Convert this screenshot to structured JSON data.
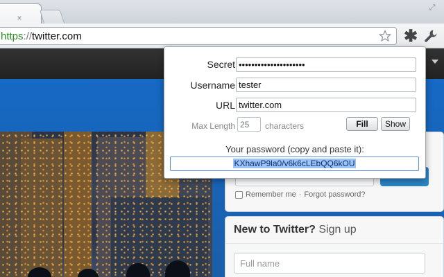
{
  "browser": {
    "new_tab_label": "",
    "close_glyph": "×",
    "address": {
      "scheme": "https",
      "separator": "://",
      "host": "twitter.com"
    }
  },
  "popup": {
    "secret": {
      "label": "Secret",
      "value": "•••••••••••••••••••••"
    },
    "username": {
      "label": "Username",
      "value": "tester"
    },
    "url": {
      "label": "URL",
      "value": "twitter.com"
    },
    "max_length": {
      "label": "Max Length",
      "value": "25",
      "unit": "characters"
    },
    "fill_button": "Fill",
    "show_button": "Show",
    "result_caption": "Your password (copy and paste it):",
    "result_value": "KXhawP9la0/v6k6cLEbQQ6kOU"
  },
  "page": {
    "remember_me": "Remember me",
    "separator": "·",
    "forgot_password": "Forgot password?",
    "signup_heading": "New to Twitter?",
    "signup_link": "Sign up",
    "full_name_placeholder": "Full name"
  },
  "icons": {
    "tab_close": "close-icon",
    "bookmark": "star-icon",
    "extension": "asterisk-icon",
    "settings": "wrench-icon"
  },
  "colors": {
    "scheme_green": "#2a8f25",
    "selection_blue": "#9cc4f6",
    "twitter_blue": "#1a68b8"
  }
}
